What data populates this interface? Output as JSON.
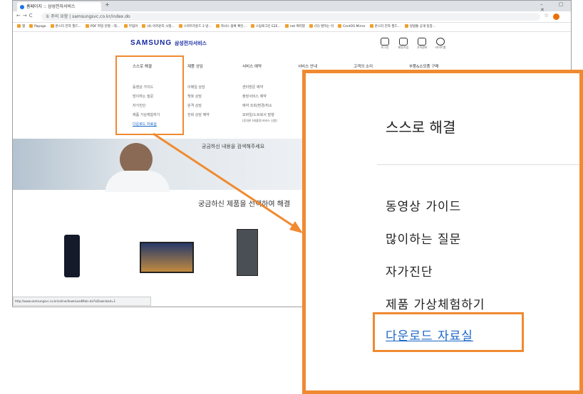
{
  "browser": {
    "tab_title": "홈페이지 :: 삼성전자서비스",
    "address": "① 주의 요함 | samsungsvc.co.kr/index.do",
    "bookmarks": [
      "앱",
      "Papago",
      "몬스터 전자 필드...",
      "PDF 파일 분할 - 대...",
      "부림어",
      "(4) 어카운티 시절...",
      "스마트라운드 2 방...",
      "자녀스 블록 확인...",
      "스팅로그인 E2E...",
      "net 여러말",
      "(다) 발하는 이",
      "CentOS Mirror",
      "몬스터 전자 필드...",
      "방범통 공개 등장..."
    ],
    "status_url": "http://www.samsungsvc.co.kr/online/downLoadMain.do?isDownload=1"
  },
  "site": {
    "logo_main": "SAMSUNG",
    "logo_sub": "삼성전자서비스",
    "utility": [
      "로그인",
      "회원가입",
      "고객센터",
      "사이트맵"
    ],
    "nav": [
      "스스로 해결",
      "제품 상담",
      "서비스 예약",
      "서비스 안내",
      "고객의 소리",
      "부품&소모품 구매"
    ],
    "self_solve_items": [
      "동영상 가이드",
      "많이하는 질문",
      "자가진단",
      "제품 가상체험하기",
      "다운로드 자료실"
    ],
    "consult_items": [
      "이메일 상담",
      "챗봇 상담",
      "원격 상담",
      "전화 상담 예약"
    ],
    "reserve_items": [
      "센터방문 예약",
      "출장서비스 예약",
      "예약 조회/변경/취소",
      "모바일/노트북서 발행",
      "(휴대폰 (태블릿/서비스 신청)"
    ],
    "hero_search": "궁금하신 내용을 검색해주세요",
    "select_product": "궁금하신 제품을 선택하여 해결"
  },
  "zoom": {
    "heading": "스스로 해결",
    "items": [
      "동영상 가이드",
      "많이하는 질문",
      "자가진단",
      "제품 가상체험하기"
    ],
    "highlight_link": "다운로드 자료실"
  },
  "colors": {
    "highlight": "#f08a30",
    "brand": "#1428a0",
    "link": "#1a66c5"
  }
}
